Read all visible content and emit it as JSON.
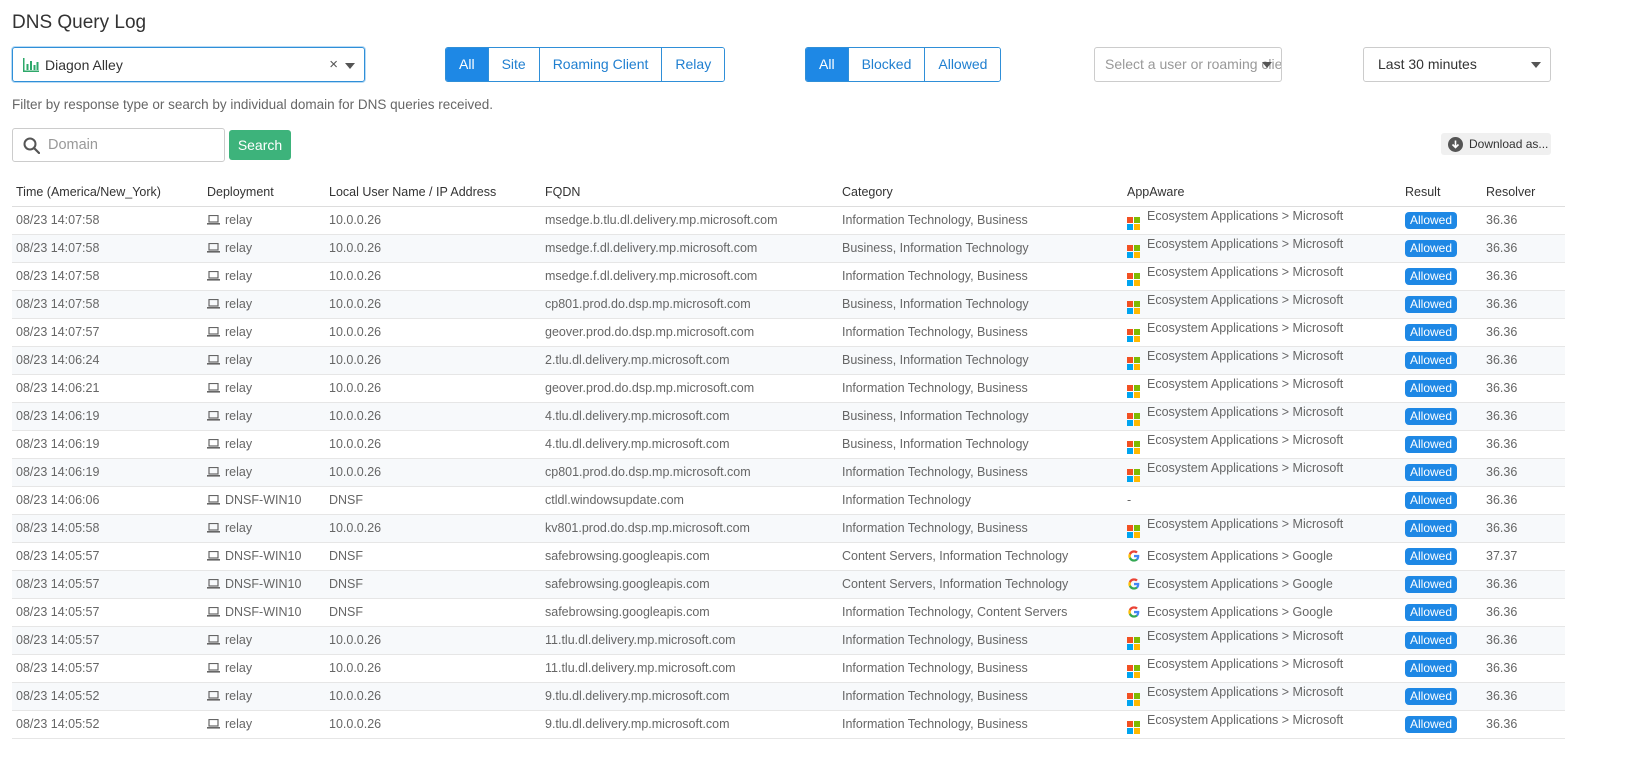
{
  "page": {
    "title": "DNS Query Log"
  },
  "filters": {
    "site": {
      "value": "Diagon Alley",
      "clear_icon": "×"
    },
    "deployment_types": [
      "All",
      "Site",
      "Roaming Client",
      "Relay"
    ],
    "deployment_active": "All",
    "response_types": [
      "All",
      "Blocked",
      "Allowed"
    ],
    "response_active": "All",
    "user_select": {
      "placeholder": "Select a user or roaming client"
    },
    "time_range": {
      "value": "Last 30 minutes"
    },
    "help_text": "Filter by response type or search by individual domain for DNS queries received."
  },
  "search": {
    "placeholder": "Domain",
    "button_label": "Search"
  },
  "download": {
    "label": "Download as..."
  },
  "colors": {
    "accent": "#1e88e5",
    "search_green": "#3db37b",
    "badge_allowed": "#1e88e5"
  },
  "table": {
    "columns": [
      "Time (America/New_York)",
      "Deployment",
      "Local User Name / IP Address",
      "FQDN",
      "Category",
      "AppAware",
      "Result",
      "Resolver"
    ],
    "rows": [
      {
        "time": "08/23 14:07:58",
        "deployment": "relay",
        "user": "10.0.0.26",
        "fqdn": "msedge.b.tlu.dl.delivery.mp.microsoft.com",
        "category": "Information Technology, Business",
        "app_icon": "microsoft-icon",
        "app": "Ecosystem Applications > Microsoft",
        "result": "Allowed",
        "resolver": "36.36"
      },
      {
        "time": "08/23 14:07:58",
        "deployment": "relay",
        "user": "10.0.0.26",
        "fqdn": "msedge.f.dl.delivery.mp.microsoft.com",
        "category": "Business, Information Technology",
        "app_icon": "microsoft-icon",
        "app": "Ecosystem Applications > Microsoft",
        "result": "Allowed",
        "resolver": "36.36"
      },
      {
        "time": "08/23 14:07:58",
        "deployment": "relay",
        "user": "10.0.0.26",
        "fqdn": "msedge.f.dl.delivery.mp.microsoft.com",
        "category": "Information Technology, Business",
        "app_icon": "microsoft-icon",
        "app": "Ecosystem Applications > Microsoft",
        "result": "Allowed",
        "resolver": "36.36"
      },
      {
        "time": "08/23 14:07:58",
        "deployment": "relay",
        "user": "10.0.0.26",
        "fqdn": "cp801.prod.do.dsp.mp.microsoft.com",
        "category": "Business, Information Technology",
        "app_icon": "microsoft-icon",
        "app": "Ecosystem Applications > Microsoft",
        "result": "Allowed",
        "resolver": "36.36"
      },
      {
        "time": "08/23 14:07:57",
        "deployment": "relay",
        "user": "10.0.0.26",
        "fqdn": "geover.prod.do.dsp.mp.microsoft.com",
        "category": "Information Technology, Business",
        "app_icon": "microsoft-icon",
        "app": "Ecosystem Applications > Microsoft",
        "result": "Allowed",
        "resolver": "36.36"
      },
      {
        "time": "08/23 14:06:24",
        "deployment": "relay",
        "user": "10.0.0.26",
        "fqdn": "2.tlu.dl.delivery.mp.microsoft.com",
        "category": "Business, Information Technology",
        "app_icon": "microsoft-icon",
        "app": "Ecosystem Applications > Microsoft",
        "result": "Allowed",
        "resolver": "36.36"
      },
      {
        "time": "08/23 14:06:21",
        "deployment": "relay",
        "user": "10.0.0.26",
        "fqdn": "geover.prod.do.dsp.mp.microsoft.com",
        "category": "Information Technology, Business",
        "app_icon": "microsoft-icon",
        "app": "Ecosystem Applications > Microsoft",
        "result": "Allowed",
        "resolver": "36.36"
      },
      {
        "time": "08/23 14:06:19",
        "deployment": "relay",
        "user": "10.0.0.26",
        "fqdn": "4.tlu.dl.delivery.mp.microsoft.com",
        "category": "Business, Information Technology",
        "app_icon": "microsoft-icon",
        "app": "Ecosystem Applications > Microsoft",
        "result": "Allowed",
        "resolver": "36.36"
      },
      {
        "time": "08/23 14:06:19",
        "deployment": "relay",
        "user": "10.0.0.26",
        "fqdn": "4.tlu.dl.delivery.mp.microsoft.com",
        "category": "Business, Information Technology",
        "app_icon": "microsoft-icon",
        "app": "Ecosystem Applications > Microsoft",
        "result": "Allowed",
        "resolver": "36.36"
      },
      {
        "time": "08/23 14:06:19",
        "deployment": "relay",
        "user": "10.0.0.26",
        "fqdn": "cp801.prod.do.dsp.mp.microsoft.com",
        "category": "Information Technology, Business",
        "app_icon": "microsoft-icon",
        "app": "Ecosystem Applications > Microsoft",
        "result": "Allowed",
        "resolver": "36.36"
      },
      {
        "time": "08/23 14:06:06",
        "deployment": "DNSF-WIN10",
        "user": "DNSF",
        "fqdn": "ctldl.windowsupdate.com",
        "category": "Information Technology",
        "app_icon": "",
        "app": "-",
        "result": "Allowed",
        "resolver": "36.36"
      },
      {
        "time": "08/23 14:05:58",
        "deployment": "relay",
        "user": "10.0.0.26",
        "fqdn": "kv801.prod.do.dsp.mp.microsoft.com",
        "category": "Information Technology, Business",
        "app_icon": "microsoft-icon",
        "app": "Ecosystem Applications > Microsoft",
        "result": "Allowed",
        "resolver": "36.36"
      },
      {
        "time": "08/23 14:05:57",
        "deployment": "DNSF-WIN10",
        "user": "DNSF",
        "fqdn": "safebrowsing.googleapis.com",
        "category": "Content Servers, Information Technology",
        "app_icon": "google-icon",
        "app": "Ecosystem Applications > Google",
        "result": "Allowed",
        "resolver": "37.37"
      },
      {
        "time": "08/23 14:05:57",
        "deployment": "DNSF-WIN10",
        "user": "DNSF",
        "fqdn": "safebrowsing.googleapis.com",
        "category": "Content Servers, Information Technology",
        "app_icon": "google-icon",
        "app": "Ecosystem Applications > Google",
        "result": "Allowed",
        "resolver": "36.36"
      },
      {
        "time": "08/23 14:05:57",
        "deployment": "DNSF-WIN10",
        "user": "DNSF",
        "fqdn": "safebrowsing.googleapis.com",
        "category": "Information Technology, Content Servers",
        "app_icon": "google-icon",
        "app": "Ecosystem Applications > Google",
        "result": "Allowed",
        "resolver": "36.36"
      },
      {
        "time": "08/23 14:05:57",
        "deployment": "relay",
        "user": "10.0.0.26",
        "fqdn": "11.tlu.dl.delivery.mp.microsoft.com",
        "category": "Information Technology, Business",
        "app_icon": "microsoft-icon",
        "app": "Ecosystem Applications > Microsoft",
        "result": "Allowed",
        "resolver": "36.36"
      },
      {
        "time": "08/23 14:05:57",
        "deployment": "relay",
        "user": "10.0.0.26",
        "fqdn": "11.tlu.dl.delivery.mp.microsoft.com",
        "category": "Information Technology, Business",
        "app_icon": "microsoft-icon",
        "app": "Ecosystem Applications > Microsoft",
        "result": "Allowed",
        "resolver": "36.36"
      },
      {
        "time": "08/23 14:05:52",
        "deployment": "relay",
        "user": "10.0.0.26",
        "fqdn": "9.tlu.dl.delivery.mp.microsoft.com",
        "category": "Information Technology, Business",
        "app_icon": "microsoft-icon",
        "app": "Ecosystem Applications > Microsoft",
        "result": "Allowed",
        "resolver": "36.36"
      },
      {
        "time": "08/23 14:05:52",
        "deployment": "relay",
        "user": "10.0.0.26",
        "fqdn": "9.tlu.dl.delivery.mp.microsoft.com",
        "category": "Information Technology, Business",
        "app_icon": "microsoft-icon",
        "app": "Ecosystem Applications > Microsoft",
        "result": "Allowed",
        "resolver": "36.36"
      }
    ]
  }
}
